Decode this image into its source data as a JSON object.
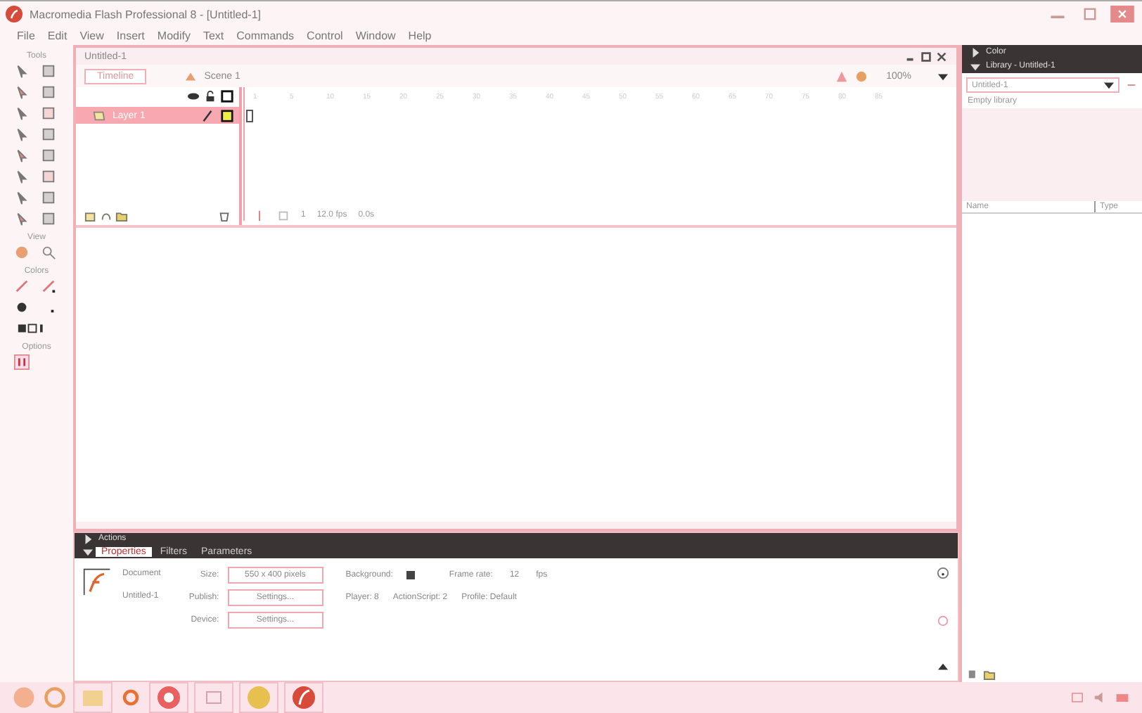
{
  "window": {
    "title": "Macromedia Flash Professional 8 - [Untitled-1]"
  },
  "menu": [
    "File",
    "Edit",
    "View",
    "Insert",
    "Modify",
    "Text",
    "Commands",
    "Control",
    "Window",
    "Help"
  ],
  "tools": {
    "sections": [
      {
        "label": "Tools",
        "kind": "tools"
      },
      {
        "label": "View",
        "kind": "view"
      },
      {
        "label": "Colors",
        "kind": "colors"
      },
      {
        "label": "Options",
        "kind": "options"
      }
    ]
  },
  "document": {
    "tab": "Untitled-1",
    "timeline_button": "Timeline",
    "scene": "Scene 1",
    "zoom": "100%",
    "frame_numbers": [
      "1",
      "5",
      "10",
      "15",
      "20",
      "25",
      "30",
      "35",
      "40",
      "45",
      "50",
      "55",
      "60",
      "65",
      "70",
      "75",
      "80",
      "85"
    ],
    "layers": [
      {
        "name": "Layer 1",
        "selected": true
      }
    ],
    "status": {
      "frame": "1",
      "fps": "12.0 fps",
      "time": "0.0s"
    }
  },
  "right_panel": {
    "color_panel": "Color",
    "library_panel": "Library - Untitled-1",
    "library_select": "Untitled-1",
    "empty_text": "Empty library",
    "columns": [
      "Name",
      "Type"
    ]
  },
  "bottom_panel": {
    "actions": "Actions",
    "tabs": [
      {
        "label": "Properties",
        "selected": true
      },
      {
        "label": "Filters",
        "selected": false
      },
      {
        "label": "Parameters",
        "selected": false
      }
    ],
    "doc_label": "Document",
    "doc_name": "Untitled-1",
    "size_label": "Size:",
    "size_value": "550 x 400 pixels",
    "background_label": "Background:",
    "frame_rate_label": "Frame rate:",
    "frame_rate": "12",
    "fps": "fps",
    "publish_label": "Publish:",
    "publish_button": "Settings...",
    "player": "Player: 8",
    "actionscript": "ActionScript: 2",
    "profile": "Profile: Default",
    "device_label": "Device:",
    "device_button": "Settings..."
  }
}
